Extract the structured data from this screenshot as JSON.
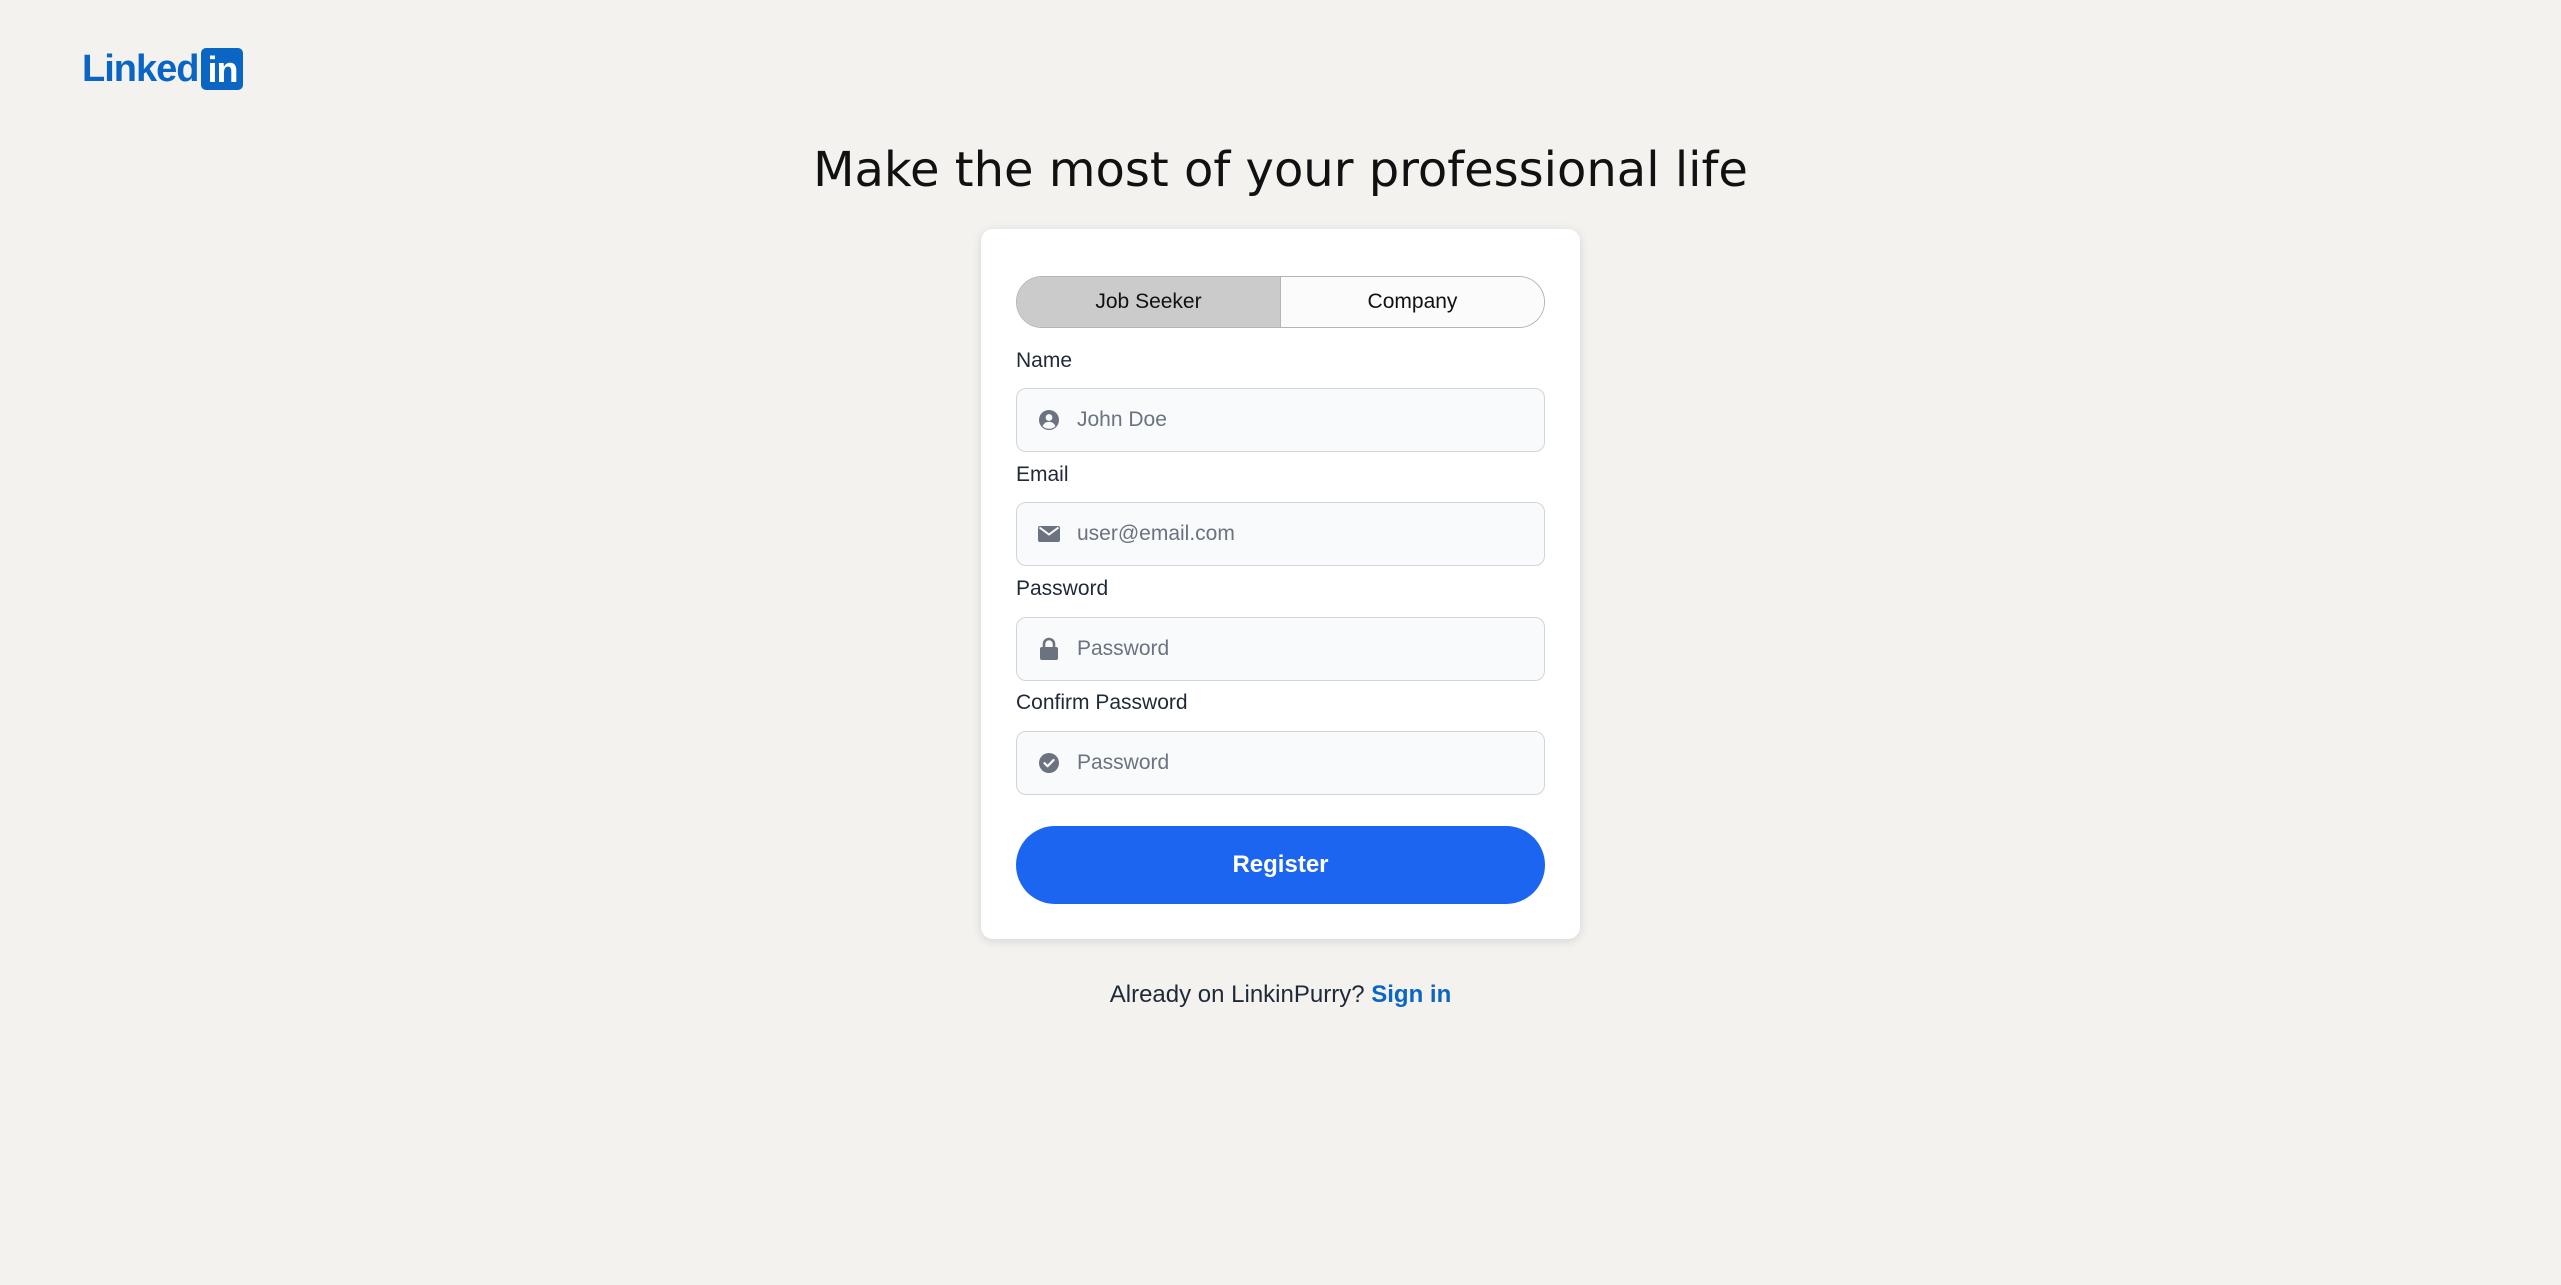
{
  "brand": {
    "logo_word": "Linked",
    "logo_box": "in",
    "color": "#0a66c2"
  },
  "headline": "Make the most of your professional life",
  "toggle": {
    "options": [
      "Job Seeker",
      "Company"
    ],
    "selected": "Job Seeker"
  },
  "form": {
    "name": {
      "label": "Name",
      "placeholder": "John Doe",
      "icon": "user-circle-icon"
    },
    "email": {
      "label": "Email",
      "placeholder": "user@email.com",
      "icon": "envelope-icon"
    },
    "password": {
      "label": "Password",
      "placeholder": "Password",
      "icon": "lock-icon"
    },
    "confirm_password": {
      "label": "Confirm Password",
      "placeholder": "Password",
      "icon": "check-circle-icon"
    },
    "submit_label": "Register",
    "submit_color": "#1b65f1"
  },
  "signin": {
    "prompt": "Already on LinkinPurry?",
    "link_label": "Sign in"
  }
}
